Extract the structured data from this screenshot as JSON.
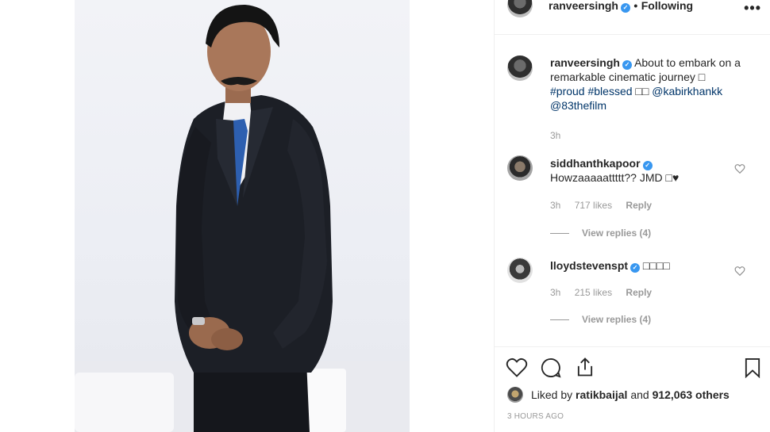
{
  "post": {
    "author": "ranveersingh",
    "follow_separator": "•",
    "follow_label": "Following",
    "more_label": "•••"
  },
  "caption": {
    "username": "ranveersingh",
    "text_line1": "About to embark on a",
    "text_line2": "remarkable cinematic journey □",
    "hashtag_proud": "#proud",
    "hashtag_blessed": "#blessed",
    "emoji_boxes": "□□",
    "mention_kabir": "@kabirkhankk",
    "mention_83": "@83thefilm",
    "time": "3h"
  },
  "comments": [
    {
      "username": "siddhanthkapoor",
      "text": "Howzaaaaattttt?? JMD □♥",
      "time": "3h",
      "likes": "717 likes",
      "reply": "Reply",
      "view_replies": "View replies (4)"
    },
    {
      "username": "lloydstevenspt",
      "text": "□□□□",
      "time": "3h",
      "likes": "215 likes",
      "reply": "Reply",
      "view_replies": "View replies (4)"
    }
  ],
  "likes": {
    "prefix": "Liked by",
    "user": "ratikbaijal",
    "middle": "and",
    "count": "912,063 others"
  },
  "timestamp": "3 HOURS AGO",
  "colors": {
    "verified": "#3897f0",
    "link": "#003569",
    "meta": "#999999",
    "text": "#262626"
  },
  "icons": [
    "heart-icon",
    "comment-icon",
    "share-icon",
    "bookmark-icon",
    "more-options-icon",
    "verified-badge-icon"
  ]
}
